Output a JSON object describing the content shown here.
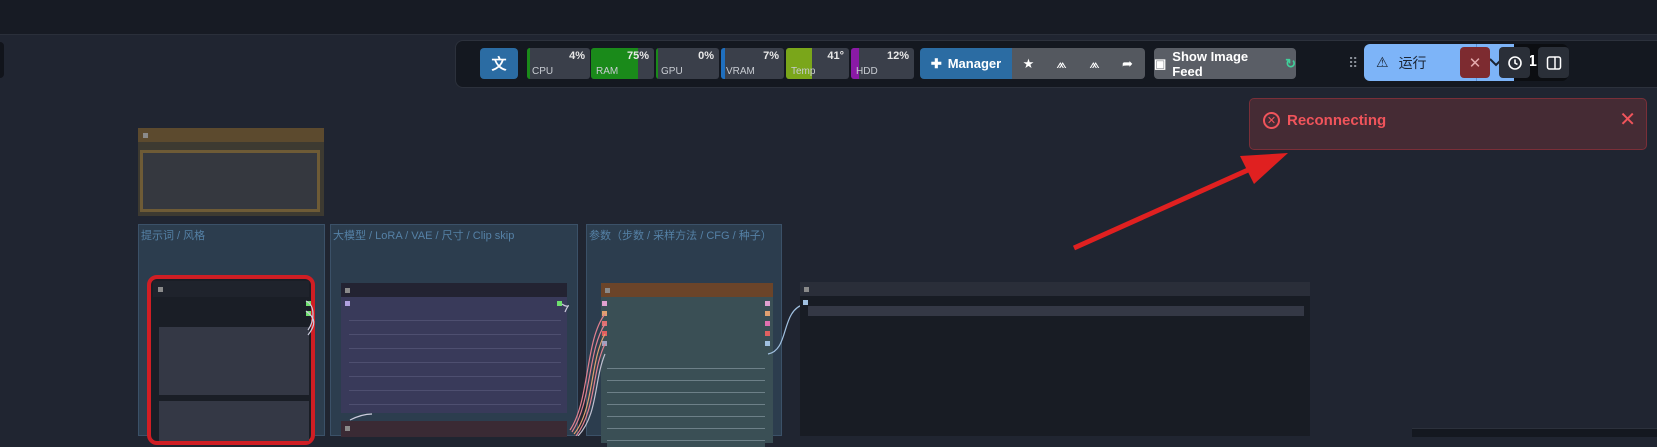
{
  "toolbar": {
    "translate_icon": "translate-icon",
    "stats": [
      {
        "label": "CPU",
        "value": "4%",
        "percent": 4,
        "color": "#1a8a1a"
      },
      {
        "label": "RAM",
        "value": "75%",
        "percent": 75,
        "color": "#1a8a1a"
      },
      {
        "label": "GPU",
        "value": "0%",
        "percent": 0,
        "color": "#1a8a1a"
      },
      {
        "label": "VRAM",
        "value": "7%",
        "percent": 7,
        "color": "#1f6fbf"
      },
      {
        "label": "Temp",
        "value": "41°",
        "percent": 41,
        "color": "#7aa61a"
      },
      {
        "label": "HDD",
        "value": "12%",
        "percent": 12,
        "color": "#8a1aa6"
      }
    ],
    "manager_label": "Manager",
    "show_image_feed_label": "Show Image Feed",
    "run_label": "运行",
    "batch_count": "1"
  },
  "toast": {
    "message": "Reconnecting",
    "icon": "error-circle-icon",
    "color": "#f0545b"
  },
  "canvas": {
    "groups": [
      {
        "label": "提示词 / 风格"
      },
      {
        "label": "大模型 / LoRA /  VAE / 尺寸 / Clip skip"
      },
      {
        "label": "参数（步数 / 采样方法 / CFG / 种子）"
      }
    ]
  },
  "colors": {
    "background": "#202531",
    "accent": "#2b6ca3",
    "run_button": "#7db4f8",
    "annotation_arrow": "#e02020"
  }
}
